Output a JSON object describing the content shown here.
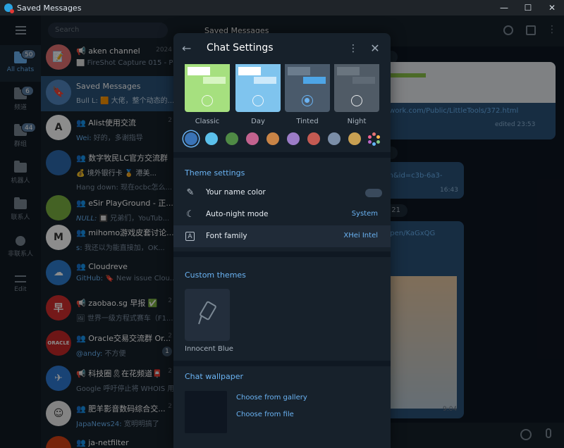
{
  "window": {
    "title": "Saved Messages",
    "minimize": "—",
    "maximize": "☐",
    "close": "✕"
  },
  "folders": {
    "items": [
      {
        "label": "All chats",
        "badge": "50",
        "active": true
      },
      {
        "label": "频道",
        "badge": "6"
      },
      {
        "label": "群组",
        "badge": "44"
      },
      {
        "label": "机器人",
        "badge": ""
      },
      {
        "label": "联系人",
        "badge": ""
      },
      {
        "label": "非联系人",
        "badge": ""
      },
      {
        "label": "Edit",
        "badge": ""
      }
    ]
  },
  "chatlist": {
    "search_placeholder": "Search",
    "chats": [
      {
        "name": "📢 aken channel",
        "time": "2024",
        "sender": "",
        "preview": "⬜ FireShot Capture 015 - Pri...",
        "color": "#e57373",
        "initial": "📝"
      },
      {
        "name": "Saved Messages",
        "time": "",
        "sender": "Bull L:",
        "preview": " 🟧 大佬，整个动态的...",
        "color": "#5288c1",
        "initial": "🔖",
        "active": true
      },
      {
        "name": "👥 Alist使用交流",
        "time": "2",
        "sender": "Wei:",
        "preview": " 好的，多谢指导",
        "color": "#ffffff",
        "initial": "A"
      },
      {
        "name": "👥 数字牧民LC官方交流群",
        "time": "",
        "sender": "",
        "preview": "💰 境外银行卡 🏅 港美...",
        "color": "#2c6bb0",
        "initial": ""
      },
      {
        "name": "",
        "time": "",
        "sender": "Hang down:",
        "preview": " 现在ocbc怎么...",
        "color": "",
        "initial": ""
      },
      {
        "name": "👥 eSir PlayGround - 正...",
        "time": "",
        "sender": "NULL:",
        "preview": " 🔲 兄弟们，YouTub...",
        "color": "#7cb342",
        "initial": ""
      },
      {
        "name": "👥 mihomo游戏皮套讨论...",
        "time": "",
        "sender": "s:",
        "preview": " 我还以为能直接加，OK...",
        "color": "#ffffff",
        "initial": "M"
      },
      {
        "name": "👥 Cloudreve",
        "time": "",
        "sender": "GitHub:",
        "preview": " 🔖 New issue Clou...",
        "color": "#2f7fd1",
        "initial": "☁"
      },
      {
        "name": "📢 zaobao.sg 早报 ✅",
        "time": "2",
        "sender": "",
        "preview": "🖼 世界一级方程式赛车（F1...",
        "color": "#d32f2f",
        "initial": "早"
      },
      {
        "name": "👥 Oracle交易交流群 Or...",
        "time": "2",
        "sender": "@andy:",
        "preview": " 不方便",
        "color": "#c62828",
        "initial": "ORACLE"
      },
      {
        "name": "📢 科技圈🎗在花频道📮",
        "time": "2",
        "sender": "",
        "preview": "Google 呼吁停止将 WHOIS 用...",
        "color": "#2e7bd6",
        "initial": "✈"
      },
      {
        "name": "👥 肥羊影音数码综合交...",
        "time": "2",
        "sender": "JapaNews24:",
        "preview": " 宽明明搞了",
        "color": "#eeeeee",
        "initial": "☺"
      },
      {
        "name": "👥 ja-netfilter",
        "time": "",
        "sender": "",
        "preview": "",
        "color": "#d84315",
        "initial": ""
      }
    ],
    "unread": [
      "",
      "",
      "",
      "",
      "",
      "",
      "",
      "",
      "",
      "1",
      "",
      "",
      ""
    ]
  },
  "main": {
    "header_title": "Saved Messages",
    "date_pills": [
      "3",
      "2",
      "r 21"
    ],
    "link1": "etwork.com/Public/LittleTools/372.html",
    "edited": "edited 23:53",
    "link2": "am&id=c3b-6a3-",
    "time2": "16:43",
    "link3": "O/pen/KaGxQG",
    "time3": "9:04"
  },
  "dialog": {
    "title": "Chat Settings",
    "back_icon": "←",
    "menu_icon": "⋮",
    "close_icon": "✕",
    "themes": [
      {
        "label": "Classic",
        "bg": "#a6e07f",
        "b1": "#ffffff",
        "b2": "#d7f5c2",
        "selected": false
      },
      {
        "label": "Day",
        "bg": "#7fc4ee",
        "b1": "#ffffff",
        "b2": "#cde9fa",
        "selected": false
      },
      {
        "label": "Tinted",
        "bg": "#4a5a6b",
        "b1": "#6b7c8d",
        "b2": "#4ea5e6",
        "selected": true
      },
      {
        "label": "Night",
        "bg": "#505b66",
        "b1": "#6a757f",
        "b2": "#5f6a75",
        "selected": false
      }
    ],
    "accent_colors": [
      "#3a73b6",
      "#5bc0eb",
      "#4f8a45",
      "#c2628e",
      "#c98446",
      "#9c7cc7",
      "#c45a52",
      "#7b8ea8",
      "#c8a052"
    ],
    "theme_settings_title": "Theme settings",
    "rows": [
      {
        "label": "Your name color",
        "value": ""
      },
      {
        "label": "Auto-night mode",
        "value": "System"
      },
      {
        "label": "Font family",
        "value": "XHei Intel"
      }
    ],
    "custom_themes_title": "Custom themes",
    "custom_theme_label": "Innocent Blue",
    "wallpaper_title": "Chat wallpaper",
    "wallpaper_gallery": "Choose from gallery",
    "wallpaper_file": "Choose from file"
  }
}
